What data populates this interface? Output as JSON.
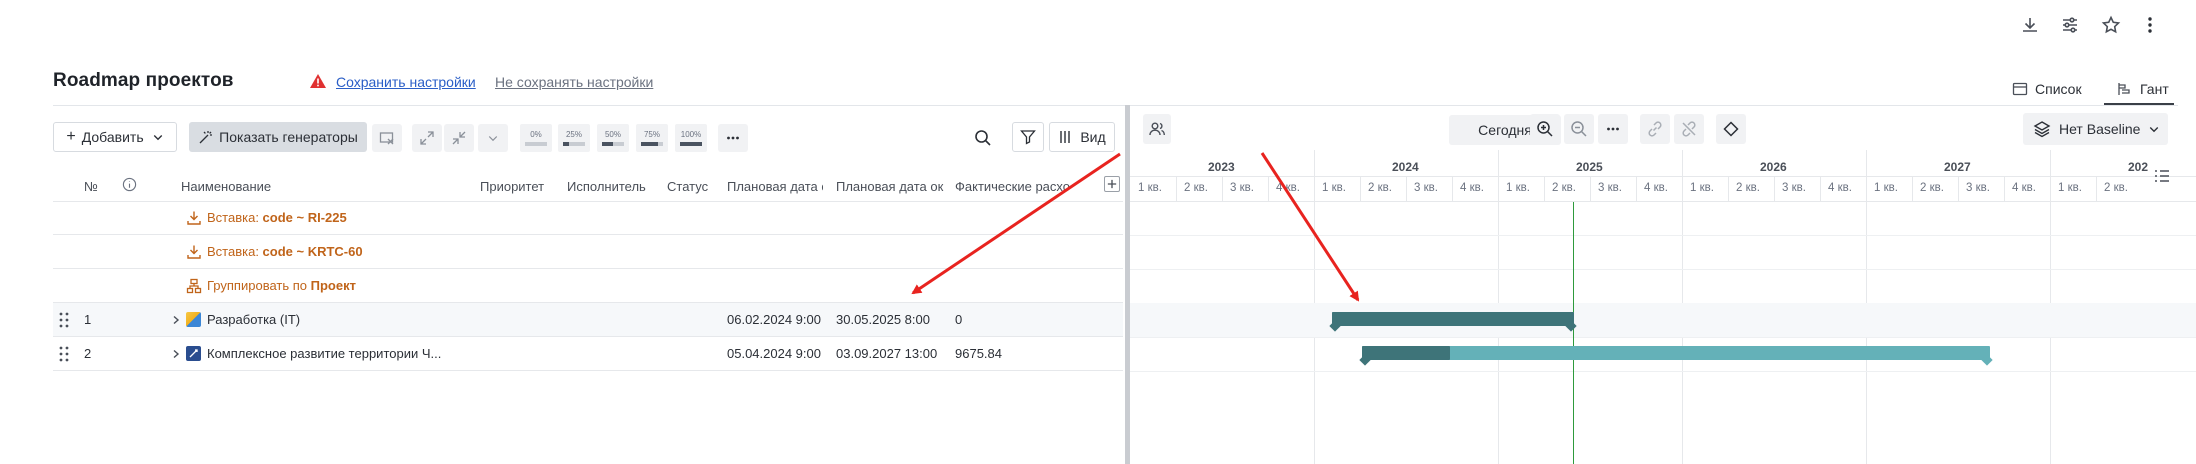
{
  "top_icons": [
    "download-icon",
    "sliders-icon",
    "star-icon",
    "more-vertical-icon"
  ],
  "page": {
    "title": "Roadmap проектов",
    "save_settings": "Сохранить настройки",
    "dont_save_settings": "Не сохранять настройки"
  },
  "views": {
    "list_label": "Список",
    "gantt_label": "Гант",
    "active": "gantt"
  },
  "toolbar": {
    "add_label": "Добавить",
    "show_generators_label": "Показать генераторы",
    "progress_buttons": [
      {
        "label": "0%",
        "fill": 0
      },
      {
        "label": "25%",
        "fill": 0.25
      },
      {
        "label": "50%",
        "fill": 0.5
      },
      {
        "label": "75%",
        "fill": 0.75
      },
      {
        "label": "100%",
        "fill": 1
      }
    ],
    "view_label": "Вид"
  },
  "table": {
    "columns": [
      "№",
      "Наименование",
      "Приоритет",
      "Исполнитель",
      "Статус",
      "Плановая дата с",
      "Плановая дата ок",
      "Фактические расхо"
    ],
    "generators": [
      {
        "prefix": "Вставка: ",
        "bold": "code ~ RI-225",
        "icon": "insert-icon"
      },
      {
        "prefix": "Вставка: ",
        "bold": "code ~ KRTC-60",
        "icon": "insert-icon"
      },
      {
        "prefix": "Группировать по ",
        "bold": "Проект",
        "icon": "group-icon"
      }
    ],
    "rows": [
      {
        "num": "1",
        "name": "Разработка (IT)",
        "start": "06.02.2024 9:00",
        "end": "30.05.2025 8:00",
        "actual": "0",
        "icon_color": "#f2b01e"
      },
      {
        "num": "2",
        "name": "Комплексное развитие территории Ч...",
        "start": "05.04.2024 9:00",
        "end": "03.09.2027 13:00",
        "actual": "9675.84",
        "icon_color": "#2a4d8f"
      }
    ]
  },
  "gantt": {
    "today_label": "Сегодня",
    "baseline_label": "Нет Baseline",
    "years": [
      {
        "label": "2023"
      },
      {
        "label": "2024"
      },
      {
        "label": "2025"
      },
      {
        "label": "2026"
      },
      {
        "label": "2027"
      },
      {
        "label": "202"
      }
    ],
    "quarters": [
      "1 кв.",
      "2 кв.",
      "3 кв.",
      "4 кв.",
      "1 кв.",
      "2 кв.",
      "3 кв.",
      "4 кв.",
      "1 кв.",
      "2 кв.",
      "3 кв.",
      "4 кв.",
      "1 кв.",
      "2 кв.",
      "3 кв.",
      "4 кв.",
      "1 кв.",
      "2 кв.",
      "3 кв.",
      "4 кв.",
      "1 кв.",
      "2 кв."
    ],
    "bar_colors": {
      "dark": "#3e7479",
      "light": "#64b1b8",
      "today_line": "#2e9a3c"
    },
    "tasks": [
      {
        "start": "06.02.2024",
        "end": "30.05.2025",
        "progress": 1.0
      },
      {
        "start": "05.04.2024",
        "end": "03.09.2027",
        "progress": 0.14
      }
    ]
  },
  "annotation_color": "#e8231f"
}
